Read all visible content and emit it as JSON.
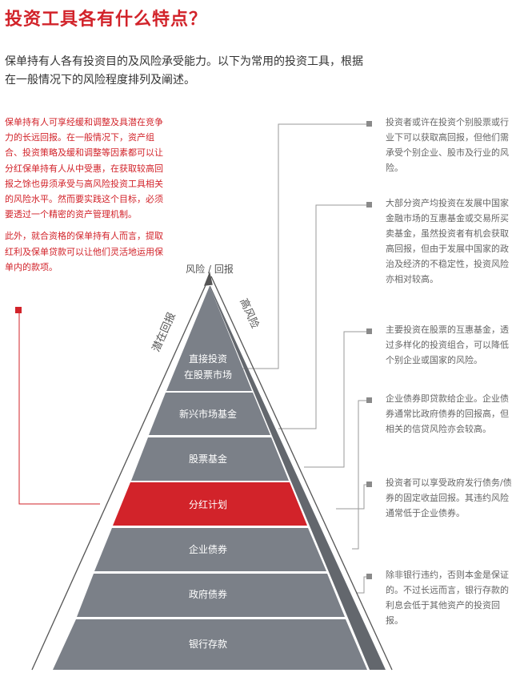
{
  "title": "投资工具各有什么特点？",
  "intro": {
    "line1": "保单持有人各有投资目的及风险承受能力。以下为常用的投资工具，根据",
    "line2": "在一般情况下的风险程度排列及阐述。"
  },
  "left_note": {
    "paragraph1": "保单持有人可享经缓和调整及具潜在竞争力的长远回报。在一般情况下，资产组合、投资策略及缓和调整等因素都可以让分红保单持有人从中受惠，在获取较高回报之馀也毋须承受与高风险投资工具相关的风险水平。然而要实践这个目标，必须要透过一个精密的资产管理机制。",
    "paragraph2": "此外，就合资格的保单持有人而言，提取红利及保单贷款可以让他们灵活地运用保单内的款项。"
  },
  "axis": {
    "top_label": "风险 / 回报",
    "left_label": "潜在回报",
    "right_label": "高风险"
  },
  "pyramid": {
    "levels": [
      {
        "line1": "直接投资",
        "line2": "在股票市场"
      },
      {
        "line1": "新兴市场基金"
      },
      {
        "line1": "股票基金"
      },
      {
        "line1": "分红计划",
        "highlight": true
      },
      {
        "line1": "企业债券"
      },
      {
        "line1": "政府债券"
      },
      {
        "line1": "银行存款"
      }
    ]
  },
  "descriptions": [
    "投资者或许在投资个别股票或行业下可以获取高回报，但他们需承受个别企业、股市及行业的风险。",
    "大部分资产均投资在发展中国家金融市场的互惠基金或交易所买卖基金，虽然投资者有机会获取高回报，但由于发展中国家的政治及经济的不稳定性，投资风险亦相对较高。",
    "主要投资在股票的互惠基金，透过多样化的投资组合，可以降低个别企业或国家的风险。",
    "企业债券即贷款给企业。企业债券通常比政府债券的回报高，但相关的信贷风险亦会较高。",
    "投资者可以享受政府发行债务/债券的固定收益回报。其违约风险通常低于企业债券。",
    "除非银行违约，否则本金是保证的。不过长远而言，银行存款的利息会低于其他资产的投资回报。"
  ],
  "colors": {
    "accent_red": "#d2232a",
    "pyramid_gray": "#7b8088",
    "pyramid_shadow": "#63676d",
    "connector_gray": "#9a9a9a",
    "text_gray": "#666666"
  }
}
